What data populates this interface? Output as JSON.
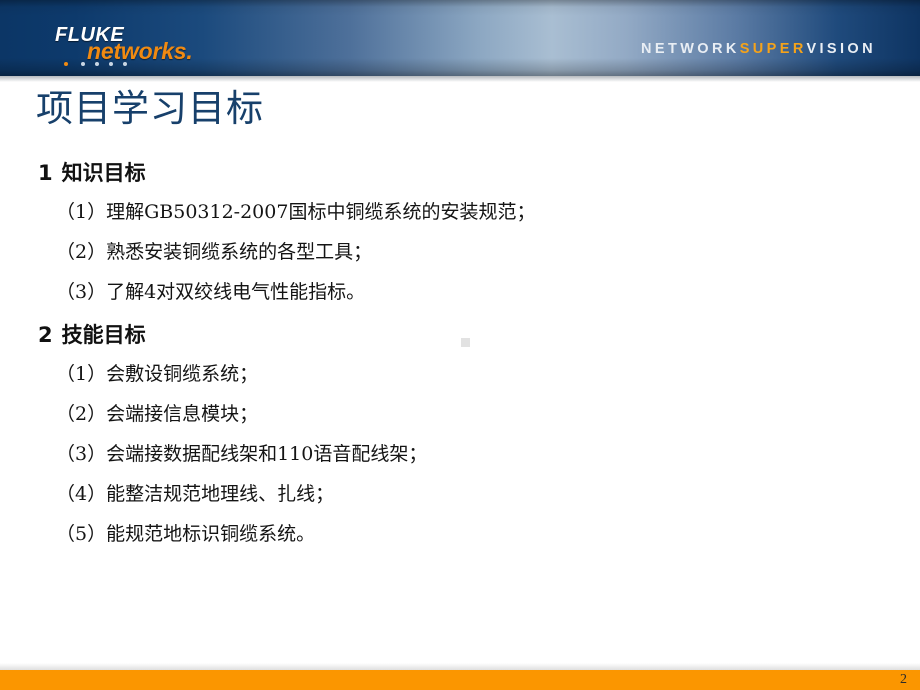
{
  "header": {
    "logo": {
      "brand_top": "FLUKE",
      "brand_bottom": "networks.",
      "dot_count": 5,
      "brand_top_color": "#ffffff",
      "brand_bottom_color": "#f08a12"
    },
    "tagline": {
      "part1": "NETWORK",
      "part2": "SUPER",
      "part3": "VISION",
      "part1_color": "#e9eef4",
      "part2_color": "#f5a31a",
      "part3_color": "#e9eef4"
    },
    "banner_gradient_from": "#0c3666",
    "banner_gradient_mid": "#a9bed2",
    "banner_gradient_to": "#0e3462"
  },
  "title": "项目学习目标",
  "title_color": "#17406b",
  "sections": [
    {
      "number": "1",
      "heading": "知识目标",
      "items": [
        "（1）理解GB50312-2007国标中铜缆系统的安装规范；",
        "（2）熟悉安装铜缆系统的各型工具；",
        "（3）了解4对双绞线电气性能指标。"
      ]
    },
    {
      "number": "2",
      "heading": "技能目标",
      "items": [
        "（1）会敷设铜缆系统；",
        "（2）会端接信息模块；",
        "（3）会端接数据配线架和110语音配线架；",
        "（4）能整洁规范地理线、扎线；",
        "（5）能规范地标识铜缆系统。"
      ]
    }
  ],
  "footer": {
    "page_number": "2",
    "bar_color": "#fb9600"
  }
}
